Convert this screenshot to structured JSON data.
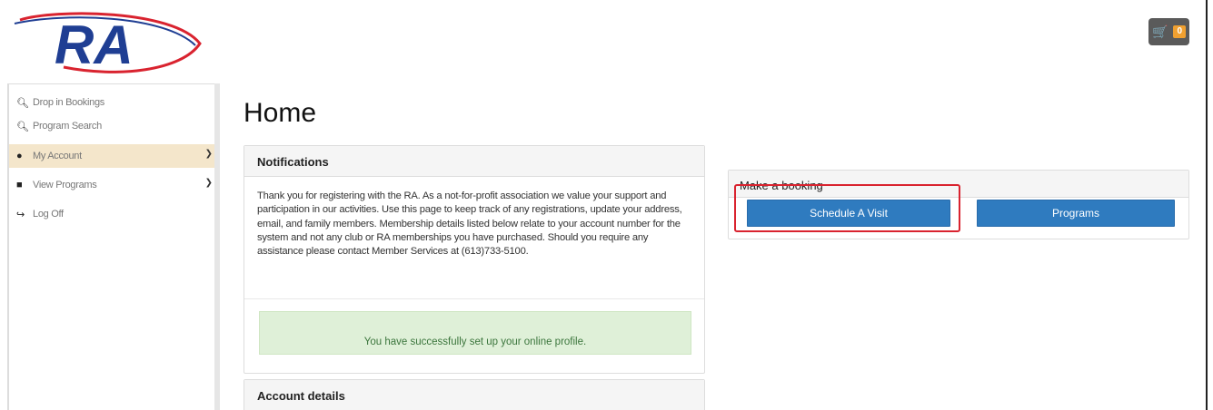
{
  "header": {
    "logo_text": "RA",
    "cart_count": "0"
  },
  "sidebar": {
    "items": [
      {
        "label": "Drop in Bookings",
        "icon": "search-icon",
        "active": false,
        "has_chevron": false
      },
      {
        "label": "Program Search",
        "icon": "search-icon",
        "active": false,
        "has_chevron": false
      },
      {
        "label": "My Account",
        "icon": "user-icon",
        "active": true,
        "has_chevron": true
      },
      {
        "label": "View Programs",
        "icon": "book-icon",
        "active": false,
        "has_chevron": true
      },
      {
        "label": "Log Off",
        "icon": "sign-out-icon",
        "active": false,
        "has_chevron": false
      }
    ]
  },
  "main": {
    "title": "Home",
    "notifications": {
      "heading": "Notifications",
      "body": "Thank you for registering with the RA. As a not-for-profit association we value your support and participation in our activities. Use this page to keep track of any registrations, update your address, email, and family members. Membership details listed below relate to your account number for the system and not any club or RA memberships you have purchased. Should you require any assistance please contact Member Services at (613)733-5100.",
      "success_message": "You have successfully set up your online profile."
    },
    "account_details": {
      "heading": "Account details"
    },
    "booking": {
      "heading": "Make a booking",
      "schedule_button": "Schedule A Visit",
      "programs_button": "Programs"
    }
  },
  "colors": {
    "logo_blue": "#1f3e93",
    "logo_red": "#d9232f",
    "primary_button": "#2f7bbf",
    "active_nav": "#f4e6cb",
    "success_bg": "#dff0d8",
    "success_text": "#3c763d",
    "cart_badge": "#f0a030",
    "highlight": "#d9232f"
  }
}
